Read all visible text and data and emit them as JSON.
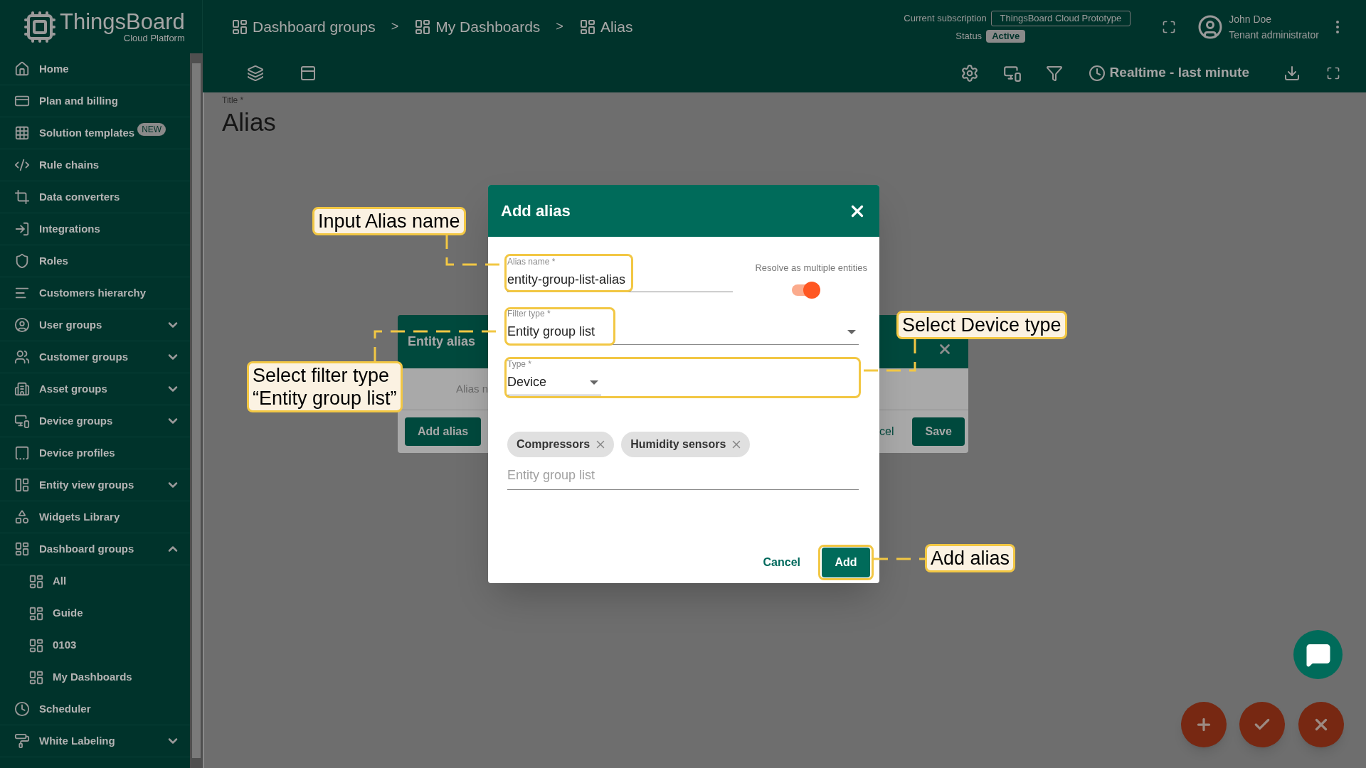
{
  "header": {
    "logo": {
      "name": "ThingsBoard",
      "subtitle": "Cloud Platform"
    },
    "breadcrumb": {
      "separator": ">",
      "items": [
        "Dashboard groups",
        "My Dashboards",
        "Alias"
      ]
    },
    "subscription": {
      "label": "Current subscription",
      "plan": "ThingsBoard Cloud Prototype",
      "status_label": "Status",
      "status": "Active"
    },
    "user": {
      "name": "John Doe",
      "role": "Tenant administrator"
    }
  },
  "toolbar": {
    "timewindow": "Realtime - last minute"
  },
  "sidebar": {
    "items": [
      {
        "label": "Home"
      },
      {
        "label": "Plan and billing"
      },
      {
        "label": "Solution templates",
        "badge": "NEW"
      },
      {
        "label": "Rule chains"
      },
      {
        "label": "Data converters"
      },
      {
        "label": "Integrations"
      },
      {
        "label": "Roles"
      },
      {
        "label": "Customers hierarchy"
      },
      {
        "label": "User groups",
        "expanded": false
      },
      {
        "label": "Customer groups",
        "expanded": false
      },
      {
        "label": "Asset groups",
        "expanded": false
      },
      {
        "label": "Device groups",
        "expanded": false
      },
      {
        "label": "Device profiles"
      },
      {
        "label": "Entity view groups",
        "expanded": false
      },
      {
        "label": "Widgets Library"
      },
      {
        "label": "Dashboard groups",
        "expanded": true,
        "children": [
          {
            "label": "All"
          },
          {
            "label": "Guide"
          },
          {
            "label": "0103"
          },
          {
            "label": "My Dashboards"
          }
        ]
      },
      {
        "label": "Scheduler"
      },
      {
        "label": "White Labeling",
        "expanded": false
      }
    ]
  },
  "dashboard": {
    "title_label": "Title *",
    "title": "Alias"
  },
  "entity_aliases_dialog": {
    "title": "Entity alias",
    "column_1": "Alias n",
    "add_button": "Add alias",
    "cancel_button": "cel",
    "save_button": "Save"
  },
  "add_alias_dialog": {
    "title": "Add alias",
    "alias_name": {
      "label": "Alias name *",
      "value": "entity-group-list-alias"
    },
    "resolve_multiple": {
      "label": "Resolve as multiple entities",
      "on": true
    },
    "filter_type": {
      "label": "Filter type *",
      "value": "Entity group list"
    },
    "type": {
      "label": "Type *",
      "value": "Device"
    },
    "entity_groups": {
      "chips": [
        "Compressors",
        "Humidity sensors"
      ],
      "placeholder": "Entity group list"
    },
    "buttons": {
      "cancel": "Cancel",
      "add": "Add"
    }
  },
  "callouts": [
    {
      "text": "Input Alias name"
    },
    {
      "text": "Select filter type\n“Entity group list”"
    },
    {
      "text": "Select Device type"
    },
    {
      "text": "Add alias"
    }
  ]
}
